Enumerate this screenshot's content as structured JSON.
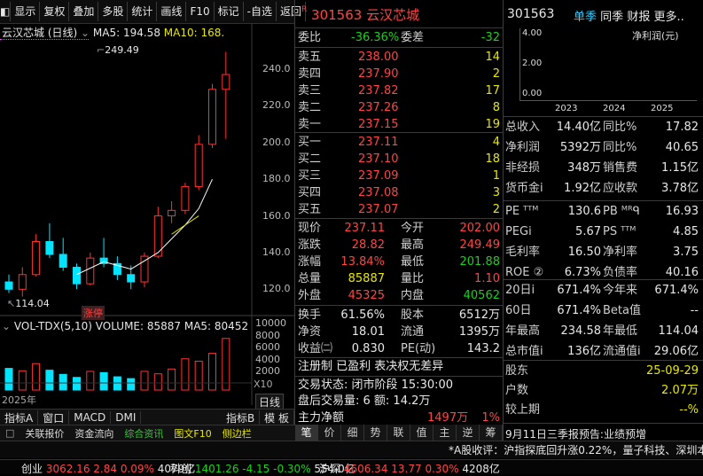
{
  "toolbar": {
    "items": [
      "显示",
      "复权",
      "叠加",
      "多股",
      "统计",
      "画线",
      "F10",
      "标记",
      "-自选",
      "返回"
    ]
  },
  "chart": {
    "title": "云汉芯城 (日线)",
    "ma5_label": "MA5: 194.58",
    "ma10_label": "MA10: 168.",
    "high_marker": "249.49",
    "low_marker": "114.04",
    "limit_badge": "涨停",
    "price_ticks": [
      "240.0",
      "220.0",
      "200.0",
      "180.0",
      "160.0",
      "140.0",
      "120.0"
    ],
    "vol_title": "VOL-TDX(5,10)",
    "volume_label": "VOLUME: 85887",
    "vol_ma5_label": "MA5: 80452",
    "vol_ticks": [
      "10000",
      "8000",
      "6000",
      "4000",
      "2000"
    ],
    "vol_unit": "X10",
    "year": "2025年",
    "period_btn": "日线",
    "bottom_tabs": [
      "指标A",
      "窗口",
      "MACD",
      "DMI"
    ],
    "bottom_right_tabs": [
      "指标B",
      "模 板"
    ],
    "colors": {
      "up": "#ff3232",
      "down": "#00ffff",
      "ma5": "#ffffff",
      "ma10": "#e8e800",
      "high": "#ff40ff"
    }
  },
  "chart_data": {
    "type": "candlestick",
    "title": "云汉芯城 (日线)",
    "ylim": [
      110,
      255
    ],
    "candles": [
      {
        "o": 124,
        "h": 128,
        "l": 118,
        "c": 120
      },
      {
        "o": 120,
        "h": 132,
        "l": 116,
        "c": 128
      },
      {
        "o": 128,
        "h": 150,
        "l": 127,
        "c": 146
      },
      {
        "o": 146,
        "h": 156,
        "l": 137,
        "c": 139
      },
      {
        "o": 139,
        "h": 148,
        "l": 130,
        "c": 132
      },
      {
        "o": 132,
        "h": 134,
        "l": 120,
        "c": 123
      },
      {
        "o": 123,
        "h": 140,
        "l": 122,
        "c": 137
      },
      {
        "o": 137,
        "h": 148,
        "l": 132,
        "c": 134
      },
      {
        "o": 134,
        "h": 138,
        "l": 125,
        "c": 128
      },
      {
        "o": 128,
        "h": 133,
        "l": 120,
        "c": 124
      },
      {
        "o": 124,
        "h": 140,
        "l": 121,
        "c": 138
      },
      {
        "o": 138,
        "h": 165,
        "l": 137,
        "c": 160
      },
      {
        "o": 160,
        "h": 168,
        "l": 156,
        "c": 163
      },
      {
        "o": 163,
        "h": 178,
        "l": 161,
        "c": 176
      },
      {
        "o": 176,
        "h": 204,
        "l": 174,
        "c": 199
      },
      {
        "o": 199,
        "h": 232,
        "l": 197,
        "c": 229
      },
      {
        "o": 229,
        "h": 249.49,
        "l": 202,
        "c": 237.11
      }
    ],
    "volumes": [
      3600,
      3200,
      4400,
      3300,
      2600,
      2100,
      3100,
      2900,
      2200,
      1900,
      3100,
      2700,
      3500,
      5200,
      4800,
      6100,
      8589
    ],
    "ma5_line": [
      [
        5,
        128
      ],
      [
        7,
        135
      ],
      [
        9,
        131
      ],
      [
        11,
        140
      ],
      [
        13,
        155
      ],
      [
        14,
        164
      ],
      [
        15,
        180
      ]
    ],
    "ma10_line": [
      [
        12,
        150
      ],
      [
        13,
        155
      ],
      [
        14,
        160
      ]
    ]
  },
  "quote": {
    "code": "301563",
    "name": "云汉芯城",
    "weibi_label": "委比",
    "weibi": "-36.36%",
    "weicha_label": "委差",
    "weicha": "-32",
    "asks": [
      {
        "label": "卖五",
        "price": "238.00",
        "vol": "14"
      },
      {
        "label": "卖四",
        "price": "237.90",
        "vol": "2"
      },
      {
        "label": "卖三",
        "price": "237.82",
        "vol": "17"
      },
      {
        "label": "卖二",
        "price": "237.26",
        "vol": "8"
      },
      {
        "label": "卖一",
        "price": "237.15",
        "vol": "19"
      }
    ],
    "bids": [
      {
        "label": "买一",
        "price": "237.11",
        "vol": "4"
      },
      {
        "label": "买二",
        "price": "237.10",
        "vol": "18"
      },
      {
        "label": "买三",
        "price": "237.09",
        "vol": "1"
      },
      {
        "label": "买四",
        "price": "237.08",
        "vol": "3"
      },
      {
        "label": "买五",
        "price": "237.07",
        "vol": "2"
      }
    ],
    "stats": [
      [
        "现价",
        "237.11",
        "今开",
        "202.00"
      ],
      [
        "涨跌",
        "28.82",
        "最高",
        "249.49"
      ],
      [
        "涨幅",
        "13.84%",
        "最低",
        "201.88"
      ],
      [
        "总量",
        "85887",
        "量比",
        "1.10"
      ],
      [
        "外盘",
        "45325",
        "内盘",
        "40562"
      ]
    ],
    "stats2": [
      [
        "换手",
        "61.56%",
        "股本",
        "6512万"
      ],
      [
        "净资",
        "18.01",
        "流通",
        "1395万"
      ],
      [
        "收益㈡",
        "0.830",
        "PE(动)",
        "143.2"
      ]
    ],
    "notice": "注册制 已盈利 表决权无差异",
    "status": "交易状态: 闭市阶段 15:30:00",
    "after": "盘后交易量: 6  额: 14.2万",
    "flow_label": "主力净额",
    "flow_val": "1497万",
    "flow_pct": "1%",
    "tabs": [
      "笔",
      "价",
      "细",
      "势",
      "联",
      "值",
      "主",
      "逆",
      "筹"
    ]
  },
  "f10": {
    "code": "301563",
    "tabs": [
      "单季",
      "同季",
      "财报",
      "更多.."
    ],
    "chart_unit": "净利润(元)",
    "yticks": [
      "4.00",
      "2.00",
      "0.00"
    ],
    "years": [
      "2023",
      "2024",
      "2025"
    ],
    "rows1": [
      [
        "总收入",
        "14.40亿",
        "同比%",
        "17.82"
      ],
      [
        "净利润",
        "5392万",
        "同比%",
        "40.65"
      ],
      [
        "非经损",
        "348万",
        "销售费",
        "1.15亿"
      ],
      [
        "货币金ⅰ",
        "1.92亿",
        "应收款",
        "3.78亿"
      ]
    ],
    "rows2": [
      [
        "PE ᵀᵀᴹ",
        "130.6",
        "PB ᴹᴿᑫ",
        "16.93"
      ],
      [
        "PEGⅰ",
        "5.67",
        "PS ᵀᵀᴹ",
        "4.85"
      ],
      [
        "毛利率",
        "16.50",
        "净利率",
        "3.75"
      ],
      [
        "ROE ②",
        "6.73%",
        "负债率",
        "40.16"
      ]
    ],
    "rows3": [
      [
        "20日ⅰ",
        "671.4%",
        "今年来",
        "671.4%"
      ],
      [
        "60日",
        "671.4%",
        "Beta值",
        "--"
      ],
      [
        "年最高",
        "234.58",
        "年最低",
        "114.04"
      ],
      [
        "总市值ⅰ",
        "136亿",
        "流通值ⅰ",
        "29.06亿"
      ]
    ],
    "rows4": [
      [
        "股东",
        "",
        "",
        "25-09-29"
      ],
      [
        "户数",
        "",
        "",
        "2.07万"
      ],
      [
        "较上期",
        "",
        "",
        "--%"
      ]
    ],
    "news": "9月11日三季报预告:业绩预增"
  },
  "bottom_tabs": [
    "关联报价",
    "资金流向",
    "综合资讯",
    "图文F10",
    "侧边栏"
  ],
  "ticker_line": "*A股收评：沪指探底回升涨0.22%，量子科技、深圳本",
  "indices": [
    {
      "name": "创业",
      "val": "3062.16",
      "chg": "2.84",
      "pct": "0.09%",
      "amt": "4079亿"
    },
    {
      "name": "科创",
      "val": "1401.26",
      "chg": "-4.15",
      "pct": "-0.30%",
      "amt": "554.0亿"
    },
    {
      "name": "沪深",
      "val": "4606.34",
      "chg": "13.77",
      "pct": "0.30%",
      "amt": "4208亿"
    }
  ]
}
